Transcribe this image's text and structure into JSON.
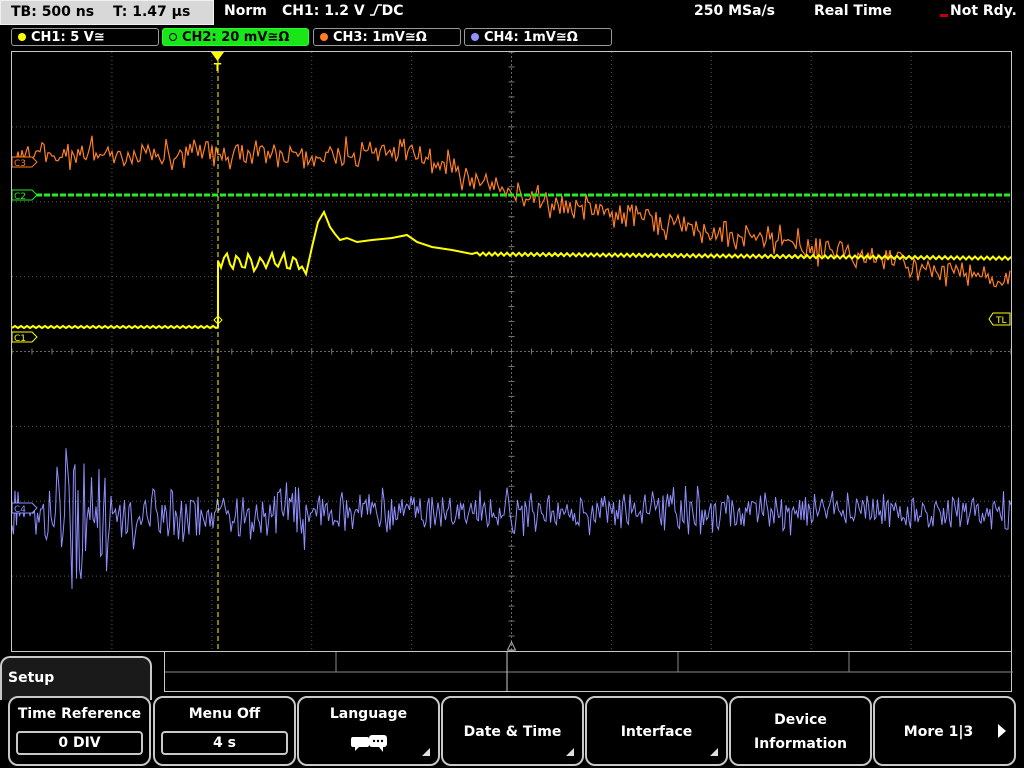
{
  "topbar": {
    "timebase": "TB: 500 ns",
    "trigger_time": "T: 1.47 µs",
    "trigger_mode": "Norm",
    "trigger_source": "CH1: 1.2 V",
    "trigger_coupling": "DC",
    "sample_rate": "250 MSa/s",
    "acq_mode": "Real Time",
    "status": "Not Rdy."
  },
  "channels": [
    {
      "label": "CH1: 5 V",
      "suffix": "≅",
      "color": "#ffff00",
      "active": false
    },
    {
      "label": "CH2: 20 mV",
      "suffix": "≅Ω",
      "color": "#22ee22",
      "active": true
    },
    {
      "label": "CH3: 1mV",
      "suffix": "≅Ω",
      "color": "#ff8020",
      "active": false
    },
    {
      "label": "CH4: 1mV",
      "suffix": "≅Ω",
      "color": "#8080ff",
      "active": false
    }
  ],
  "markers": {
    "ch1": "C1",
    "ch2": "C2",
    "ch3": "C3",
    "ch4": "C4",
    "trigger_level": "TL",
    "trigger_position": "T"
  },
  "colors": {
    "ch1": "#ffff00",
    "ch2": "#22ee22",
    "ch3": "#ff8020",
    "ch4": "#8f8fff",
    "grid": "#555555"
  },
  "menu": {
    "title": "Setup",
    "softkeys": [
      {
        "label": "Time Reference",
        "value": "0 DIV"
      },
      {
        "label": "Menu Off",
        "value": "4 s"
      },
      {
        "label": "Language",
        "icon": "language-icon"
      },
      {
        "label": "Date & Time"
      },
      {
        "label": "Interface"
      },
      {
        "label_line1": "Device",
        "label_line2": "Information"
      },
      {
        "label": "More 1|3"
      }
    ]
  }
}
